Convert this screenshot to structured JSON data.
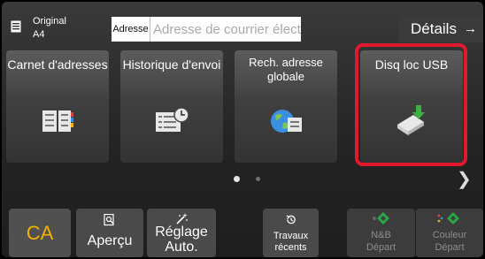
{
  "header": {
    "original_label": "Original",
    "original_size": "A4",
    "address_tag": "Adresse",
    "address_placeholder": "Adresse de courrier élect.",
    "details_label": "Détails",
    "details_arrow": "→"
  },
  "tiles": [
    {
      "label": "Carnet d'adresses",
      "icon": "address-book-icon"
    },
    {
      "label": "Historique d'envoi",
      "icon": "send-history-icon"
    },
    {
      "label": "Rech. adresse globale",
      "icon": "global-search-icon"
    },
    {
      "label": "Disq loc USB",
      "icon": "usb-drive-icon"
    }
  ],
  "pagination": {
    "pages": 2,
    "current": 1,
    "next_icon": "chevron-right-icon"
  },
  "bottom": {
    "ca_label": "CA",
    "preview_label": "Aperçu",
    "auto_line1": "Réglage",
    "auto_line2": "Auto.",
    "recent_line1": "Travaux",
    "recent_line2": "récents",
    "bw_line1": "N&B",
    "bw_line2": "Départ",
    "color_line1": "Couleur",
    "color_line2": "Départ"
  },
  "colors": {
    "highlight": "#e0192d",
    "ca_text": "#f5b000",
    "start_green": "#27a844"
  }
}
